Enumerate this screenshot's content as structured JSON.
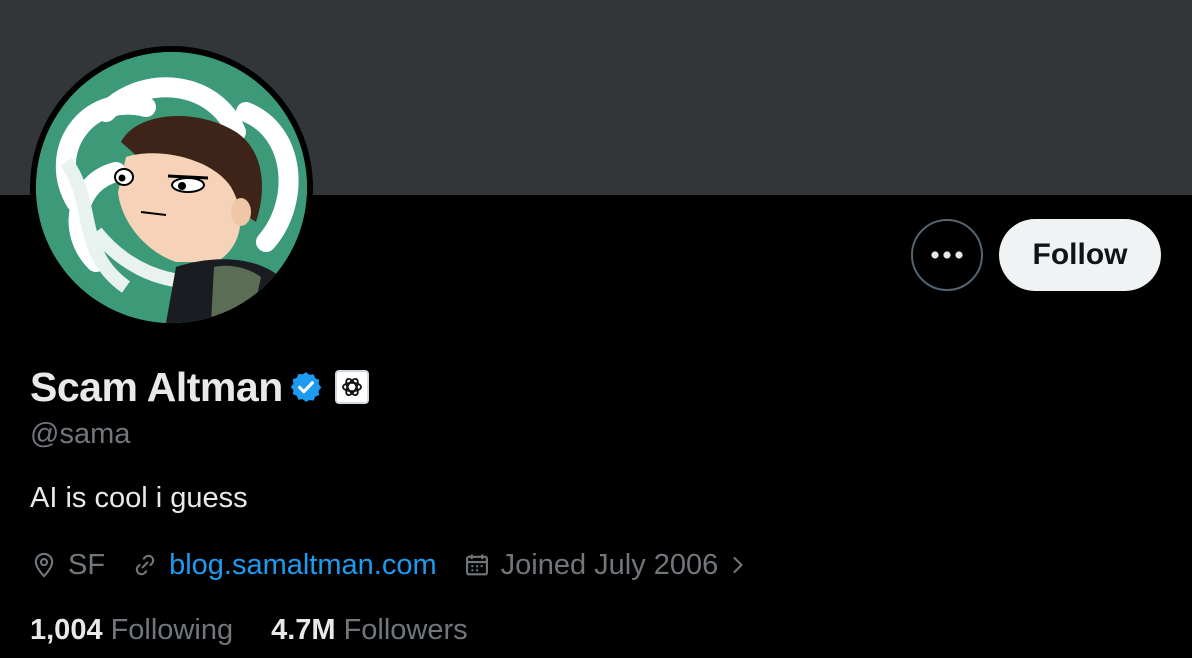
{
  "profile": {
    "display_name": "Scam Altman",
    "handle": "@sama",
    "bio": "AI is cool i guess",
    "location": "SF",
    "website": "blog.samaltman.com",
    "joined": "Joined July 2006",
    "verified": true
  },
  "actions": {
    "follow_label": "Follow",
    "more_icon": "more-horizontal-icon"
  },
  "stats": {
    "following_count": "1,004",
    "following_label": "Following",
    "followers_count": "4.7M",
    "followers_label": "Followers"
  },
  "colors": {
    "background": "#000000",
    "banner": "#333639",
    "accent": "#1d9bf0",
    "verified_badge": "#1d9bf0",
    "muted_text": "#71767b",
    "follow_button_bg": "#eff3f4",
    "avatar_bg": "#3c9a79"
  },
  "icons": {
    "location": "location-pin-icon",
    "link": "link-icon",
    "calendar": "calendar-icon",
    "chevron": "chevron-right-icon",
    "verified": "verified-badge-icon",
    "affiliate": "openai-logo-icon"
  }
}
